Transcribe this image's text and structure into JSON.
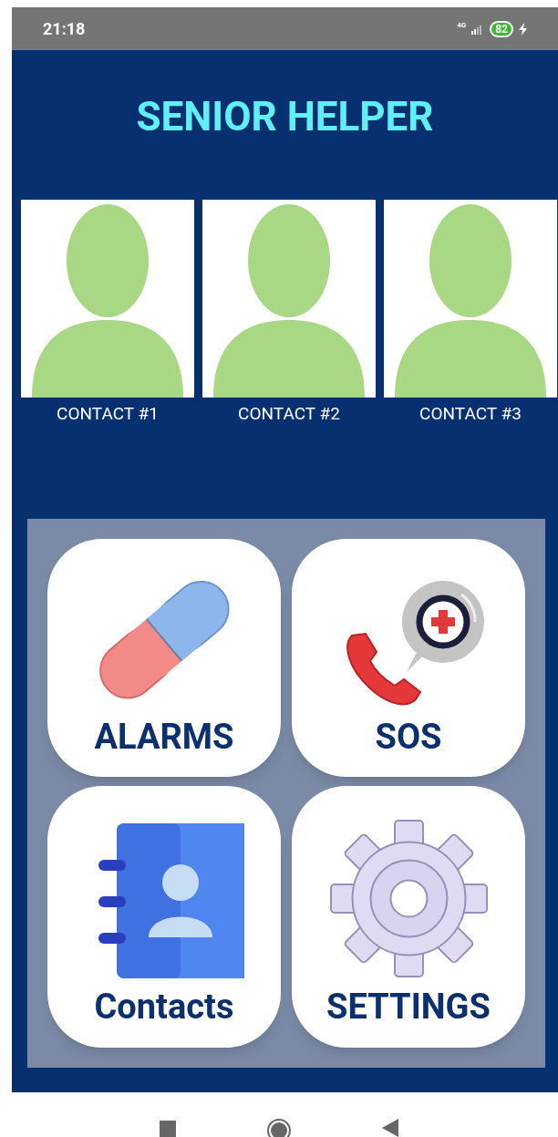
{
  "status_bar": {
    "time": "21:18",
    "network": "4G",
    "battery": "82"
  },
  "title": "SENIOR HELPER",
  "contacts": [
    {
      "label": "CONTACT #1"
    },
    {
      "label": "CONTACT #2"
    },
    {
      "label": "CONTACT #3"
    }
  ],
  "tiles": [
    {
      "kind": "pill",
      "label": "ALARMS"
    },
    {
      "kind": "sos",
      "label": "SOS"
    },
    {
      "kind": "book",
      "label": "Contacts"
    },
    {
      "kind": "gear",
      "label": "SETTINGS"
    }
  ]
}
